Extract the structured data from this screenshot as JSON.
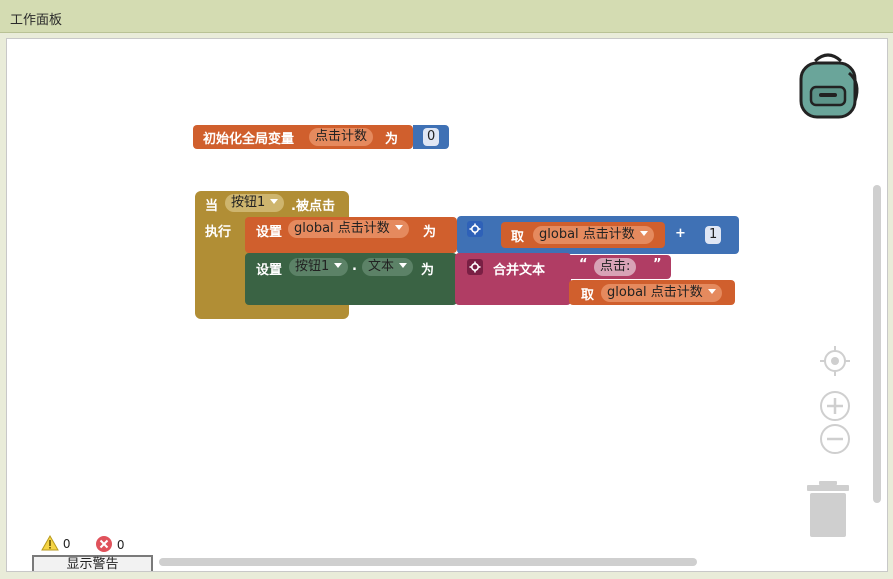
{
  "panel": {
    "title": "工作面板"
  },
  "init_block": {
    "label": "初始化全局变量",
    "var_name": "点击计数",
    "to_label": "为",
    "value": "0"
  },
  "event_block": {
    "when_label": "当",
    "component": "按钮1",
    "event": ".被点击",
    "do_label": "执行"
  },
  "set1": {
    "set_label": "设置",
    "var_name": "global 点击计数",
    "to_label": "为",
    "get_label": "取",
    "get_var": "global 点击计数",
    "op": "+",
    "num": "1"
  },
  "set2": {
    "set_label": "设置",
    "component": "按钮1",
    "dot": ".",
    "property": "文本",
    "to_label": "为",
    "join_label": "合并文本",
    "quote_open": "“",
    "string": "点击:",
    "quote_close": "”",
    "get_label": "取",
    "get_var": "global 点击计数"
  },
  "warnings": {
    "warning_count": "0",
    "error_count": "0",
    "show_button": "显示警告"
  },
  "colors": {
    "variable_block": "#d05f2d",
    "math_block": "#3f71b5",
    "event_block": "#b18e35",
    "component_set_block": "#3a6344",
    "text_block": "#b03d64",
    "titlebar": "#d4dcb2"
  }
}
